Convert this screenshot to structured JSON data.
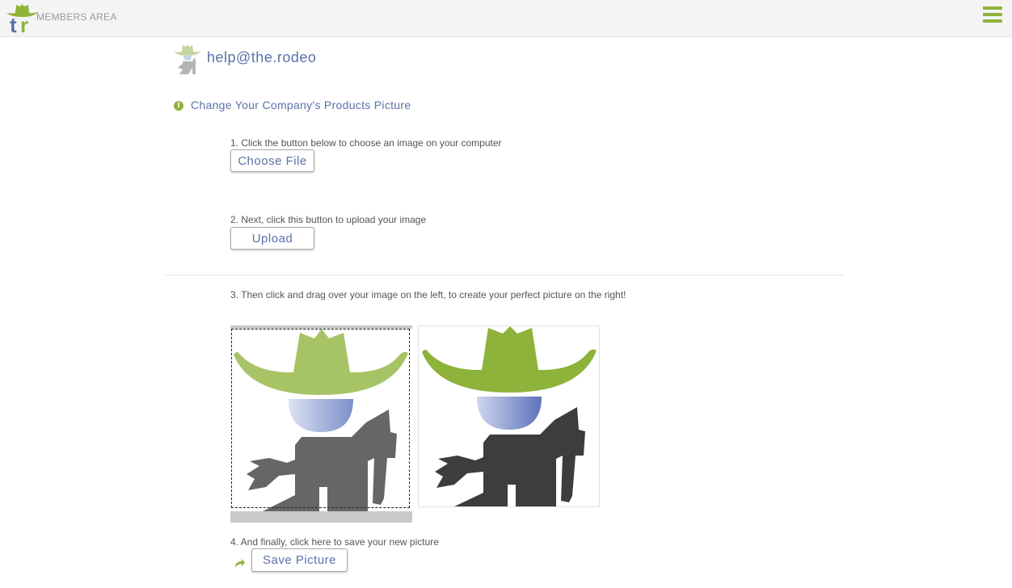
{
  "header": {
    "brand_text": "MEMBERS AREA",
    "menu_icon": "hamburger-icon"
  },
  "user": {
    "email": "help@the.rodeo"
  },
  "section": {
    "title": "Change Your Company's Products Picture",
    "icon": "info-icon"
  },
  "steps": {
    "step1_label": "1. Click the button below to choose an image on your computer",
    "choose_file_label": "Choose File",
    "step2_label": "2. Next, click this button to upload your image",
    "upload_label": "Upload",
    "step3_label": "3. Then click and drag over your image on the left, to create your perfect picture on the right!",
    "step4_label": "4. And finally, click here to save your new picture",
    "save_label": "Save Picture"
  },
  "colors": {
    "accent_green": "#8db33a",
    "light_green": "#a6c466",
    "text_blue": "#5a72a8",
    "figure_dark": "#3d3d3f",
    "figure_mid": "#666668"
  }
}
